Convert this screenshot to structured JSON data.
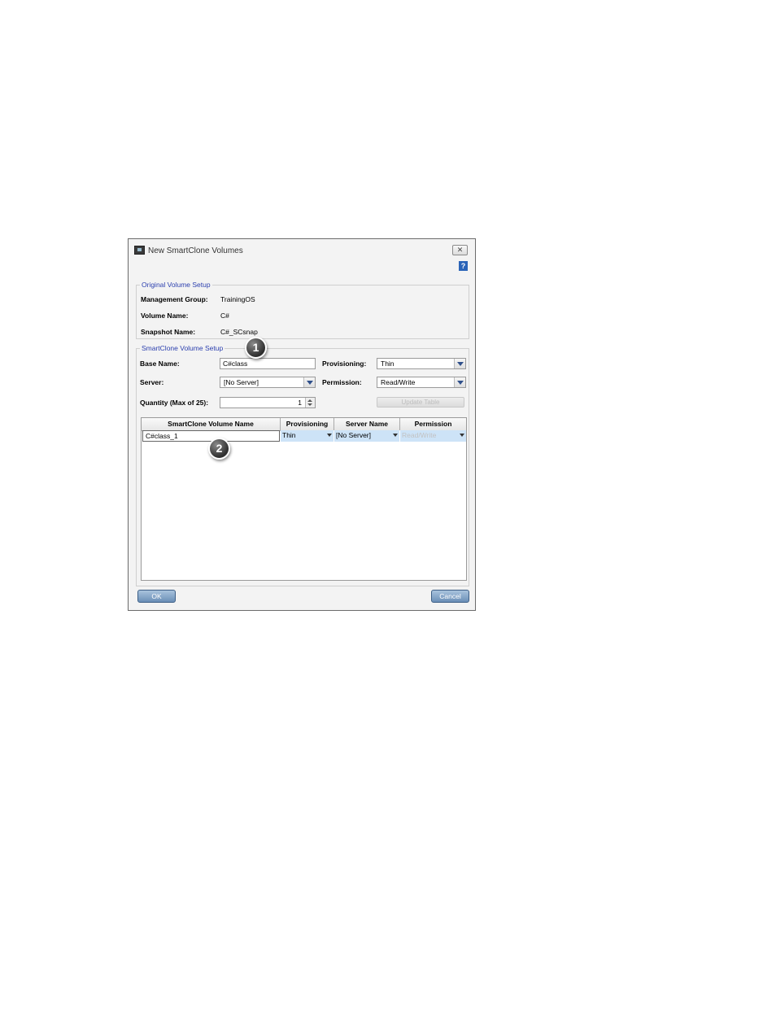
{
  "dialog": {
    "title": "New SmartClone Volumes",
    "close_glyph": "✕",
    "help_glyph": "?"
  },
  "original_setup": {
    "legend": "Original Volume Setup",
    "management_group_label": "Management Group:",
    "management_group_value": "TrainingOS",
    "volume_name_label": "Volume Name:",
    "volume_name_value": "C#",
    "snapshot_name_label": "Snapshot Name:",
    "snapshot_name_value": "C#_SCsnap"
  },
  "clone_setup": {
    "legend": "SmartClone Volume Setup",
    "base_name_label": "Base Name:",
    "base_name_value": "C#class",
    "provisioning_label": "Provisioning:",
    "provisioning_value": "Thin",
    "server_label": "Server:",
    "server_value": "[No Server]",
    "permission_label": "Permission:",
    "permission_value": "Read/Write",
    "quantity_label": "Quantity (Max of 25):",
    "quantity_value": "1",
    "update_table_label": "Update Table"
  },
  "table": {
    "headers": [
      "SmartClone Volume Name",
      "Provisioning",
      "Server Name",
      "Permission"
    ],
    "rows": [
      {
        "name": "C#class_1",
        "provisioning": "Thin",
        "server": "[No Server]",
        "permission": "Read/Write"
      }
    ]
  },
  "buttons": {
    "ok": "OK",
    "cancel": "Cancel"
  },
  "callouts": {
    "one": "1",
    "two": "2"
  },
  "colors": {
    "legend_text": "#2b3fae",
    "button_blue": "#6b8fb7",
    "selected_cell": "#cde3f7"
  }
}
